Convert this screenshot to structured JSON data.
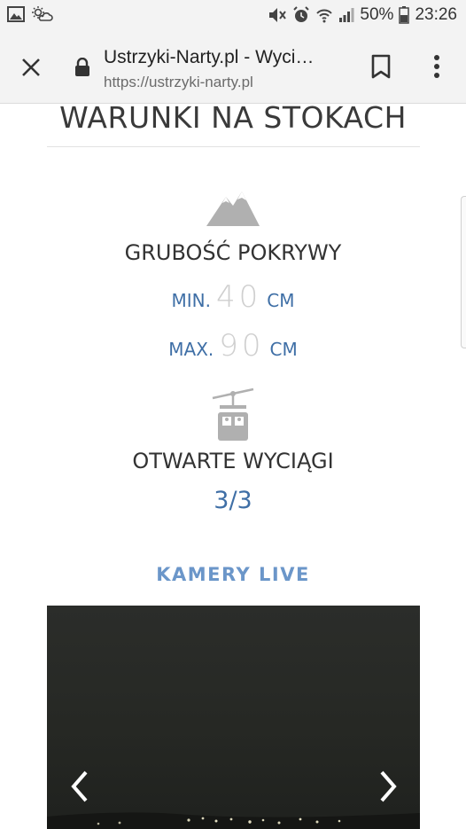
{
  "status_bar": {
    "battery": "50%",
    "time": "23:26",
    "icons": [
      "image-icon",
      "weather-icon",
      "mute-icon",
      "alarm-icon",
      "wifi-icon",
      "signal-icon",
      "battery-icon"
    ]
  },
  "toolbar": {
    "title": "Ustrzyki-Narty.pl - Wyci…",
    "url_scheme": "https://",
    "url_host": "ustrzyki-narty.pl",
    "icons": [
      "close-icon",
      "lock-icon",
      "bookmark-icon",
      "more-icon"
    ]
  },
  "content": {
    "section_title": "WARUNKI NA STOKACH",
    "snow": {
      "label": "GRUBOŚĆ POKRYWY",
      "min_label": "MIN.",
      "min_value": "40",
      "max_label": "MAX.",
      "max_value": "90",
      "unit": "CM"
    },
    "lifts": {
      "label": "OTWARTE WYCIĄGI",
      "count": "3/3"
    },
    "cameras": {
      "label": "KAMERY LIVE"
    }
  },
  "colors": {
    "accent_blue": "#3f6fa6",
    "light_blue": "#6b96c9",
    "muted_number": "#cfcfcf",
    "icon_gray": "#b0b0b0",
    "dark_text": "#333333"
  }
}
